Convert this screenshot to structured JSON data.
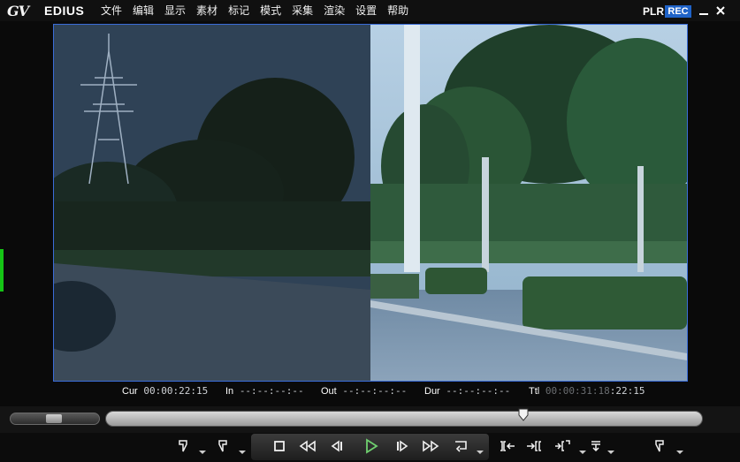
{
  "app": {
    "logo_mark": "GV",
    "logo_text": "EDIUS",
    "menu": [
      "文件",
      "编辑",
      "显示",
      "素材",
      "标记",
      "模式",
      "采集",
      "渲染",
      "设置",
      "帮助"
    ],
    "mode_plr": "PLR",
    "mode_rec": "REC",
    "accent_color": "#1f63c8"
  },
  "timecode": {
    "cur_label": "Cur",
    "cur_value": "00:00:22:15",
    "in_label": "In",
    "in_value": "--:--:--:--",
    "out_label": "Out",
    "out_value": "--:--:--:--",
    "dur_label": "Dur",
    "dur_value": "--:--:--:--",
    "ttl_label": "Ttl",
    "ttl_dim": "00:00:31:18",
    "ttl_value": ":22:15"
  },
  "transport": {
    "playhead_fraction": 0.7,
    "icons": [
      "set-in-icon",
      "set-out-icon",
      "stop-icon",
      "rewind-icon",
      "step-back-icon",
      "play-icon",
      "step-forward-icon",
      "fast-forward-icon",
      "loop-icon",
      "prev-edit-icon",
      "next-edit-icon",
      "insert-icon",
      "overwrite-icon",
      "marker-icon"
    ]
  }
}
